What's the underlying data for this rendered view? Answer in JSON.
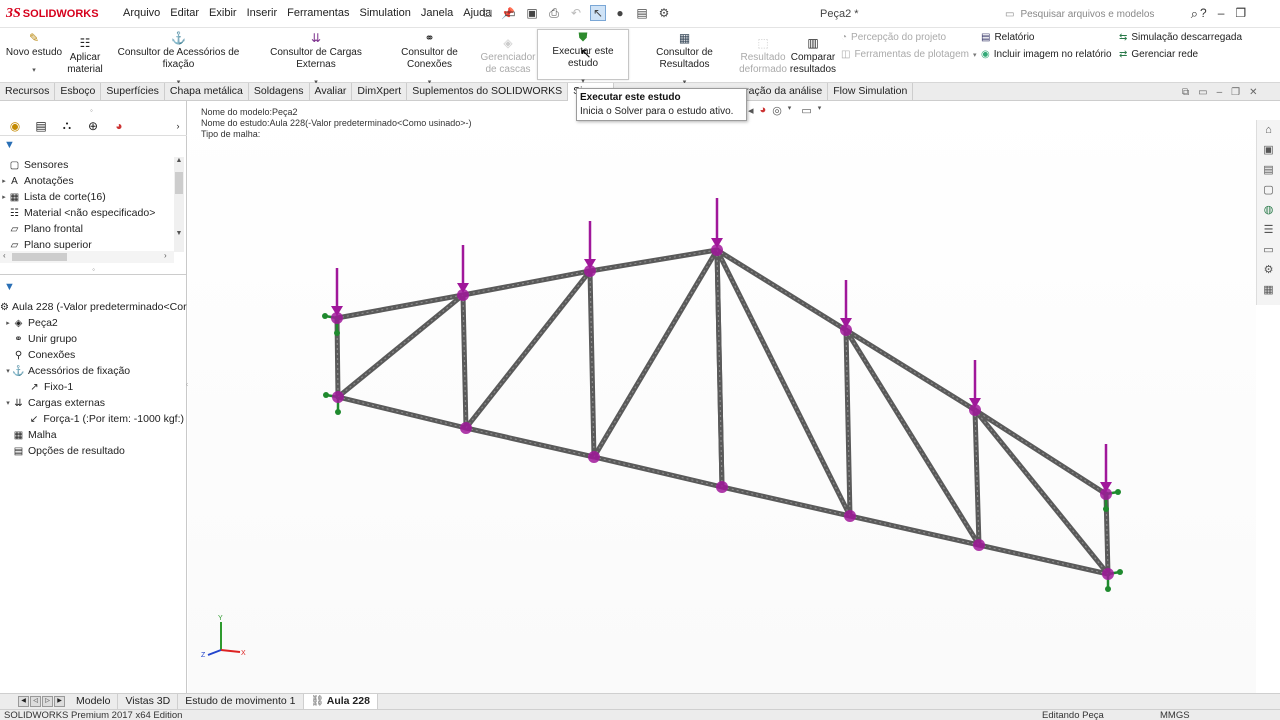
{
  "app": {
    "logo_prefix": "3S",
    "logo_name": "SOLIDWORKS",
    "doc_title": "Peça2 *"
  },
  "menu": [
    "Arquivo",
    "Editar",
    "Exibir",
    "Inserir",
    "Ferramentas",
    "Simulation",
    "Janela",
    "Ajuda"
  ],
  "search": {
    "placeholder": "Pesquisar arquivos e modelos"
  },
  "ribbon": {
    "new_study": "Novo estudo",
    "apply_material_1": "Aplicar",
    "apply_material_2": "material",
    "fixtures_advisor": "Consultor de Acessórios de fixação",
    "loads_advisor": "Consultor de Cargas Externas",
    "connections_advisor": "Consultor de Conexões",
    "shell_manager_1": "Gerenciador",
    "shell_manager_2": "de cascas",
    "run_study": "Executar este estudo",
    "results_advisor": "Consultor de Resultados",
    "deformed_result_1": "Resultado",
    "deformed_result_2": "deformado",
    "compare_results_1": "Comparar",
    "compare_results_2": "resultados",
    "design_insight": "Percepção do projeto",
    "plot_tools": "Ferramentas de plotagem",
    "report": "Relatório",
    "include_image": "Incluir imagem no relatório",
    "offloaded_sim": "Simulação descarregada",
    "manage_network": "Gerenciar rede"
  },
  "tabs": [
    "Recursos",
    "Esboço",
    "Superfícies",
    "Chapa metálica",
    "Soldagens",
    "Avaliar",
    "DimXpert",
    "Suplementos do SOLIDWORKS",
    "Sim",
    "ração da análise",
    "Flow Simulation"
  ],
  "tooltip": {
    "title": "Executar este estudo",
    "desc": "Inicia o Solver para o estudo ativo."
  },
  "tree_top": [
    "Sensores",
    "Anotações",
    "Lista de corte(16)",
    "Material <não especificado>",
    "Plano frontal",
    "Plano superior"
  ],
  "sim_tree": [
    {
      "label": "Aula 228 (-Valor predeterminado<Cor",
      "indent": 0,
      "icon": "study-icon"
    },
    {
      "label": "Peça2",
      "indent": 1,
      "icon": "part-icon"
    },
    {
      "label": "Unir grupo",
      "indent": 1,
      "icon": "group-icon"
    },
    {
      "label": "Conexões",
      "indent": 1,
      "icon": "connections-icon"
    },
    {
      "label": "Acessórios de fixação",
      "indent": 1,
      "icon": "fixtures-icon"
    },
    {
      "label": "Fixo-1",
      "indent": 2,
      "icon": "fixed-icon"
    },
    {
      "label": "Cargas externas",
      "indent": 1,
      "icon": "loads-icon"
    },
    {
      "label": "Força-1 (:Por item: -1000 kgf:)",
      "indent": 2,
      "icon": "force-icon"
    },
    {
      "label": "Malha",
      "indent": 1,
      "icon": "mesh-icon"
    },
    {
      "label": "Opções de resultado",
      "indent": 1,
      "icon": "result-options-icon"
    }
  ],
  "viewport_info": {
    "model_name": "Nome do modelo:Peça2",
    "study_name": "Nome do estudo:Aula 228(-Valor predeterminado<Como usinado>-)",
    "mesh_type": "Tipo de malha:"
  },
  "bottom_tabs": [
    "Modelo",
    "Vistas 3D",
    "Estudo de movimento 1",
    "Aula 228"
  ],
  "status": {
    "left": "SOLIDWORKS Premium 2017 x64 Edition",
    "mid": "Editando Peça",
    "units": "MMGS"
  },
  "colors": {
    "load": "#a0179a",
    "fixture": "#1f8a2e",
    "member": "#5a5a5a",
    "brand": "#d6001c"
  }
}
